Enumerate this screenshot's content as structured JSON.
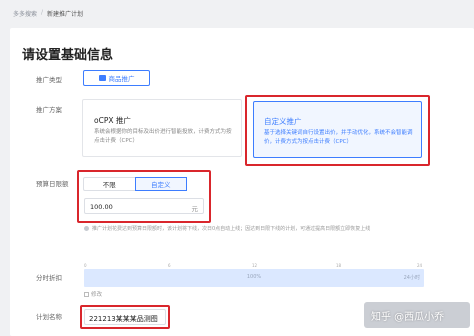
{
  "breadcrumb": {
    "root": "多多搜索",
    "sep": "/",
    "current": "新建推广计划"
  },
  "page": {
    "title": "请设置基础信息"
  },
  "labels": {
    "promo_type": "推广类型",
    "promo_plan": "推广方案",
    "budget": "预算日限额",
    "time_slot": "分时折扣",
    "plan_name": "计划名称"
  },
  "promo_type": {
    "value": "商品推广"
  },
  "plans": [
    {
      "title": "oCPX 推广",
      "desc": "系统会根据你的目标及出价进行智能投放，计费方式为按点击计费（CPC）"
    },
    {
      "title": "自定义推广",
      "desc": "基于选择关键词自行设置出价，并手动优化，系统不会智能调价，计费方式为按点击计费（CPC）"
    }
  ],
  "budget_seg": {
    "opt1": "不限",
    "opt2": "自定义"
  },
  "budget": {
    "value": "100.00",
    "unit": "元"
  },
  "hint": "推广计划花费达到预算日限额时，该计划将下线，次日0点自动上线；因达到日限下线的计划，可通过提高日限额立即恢复上线",
  "timebar": {
    "percent": "100%",
    "side": "24小时",
    "ticks": [
      "0",
      "6",
      "12",
      "18",
      "24"
    ]
  },
  "edit": "修改",
  "plan_name": {
    "value": "221213某某某品测图"
  },
  "watermark": "知乎 @西瓜小乔"
}
